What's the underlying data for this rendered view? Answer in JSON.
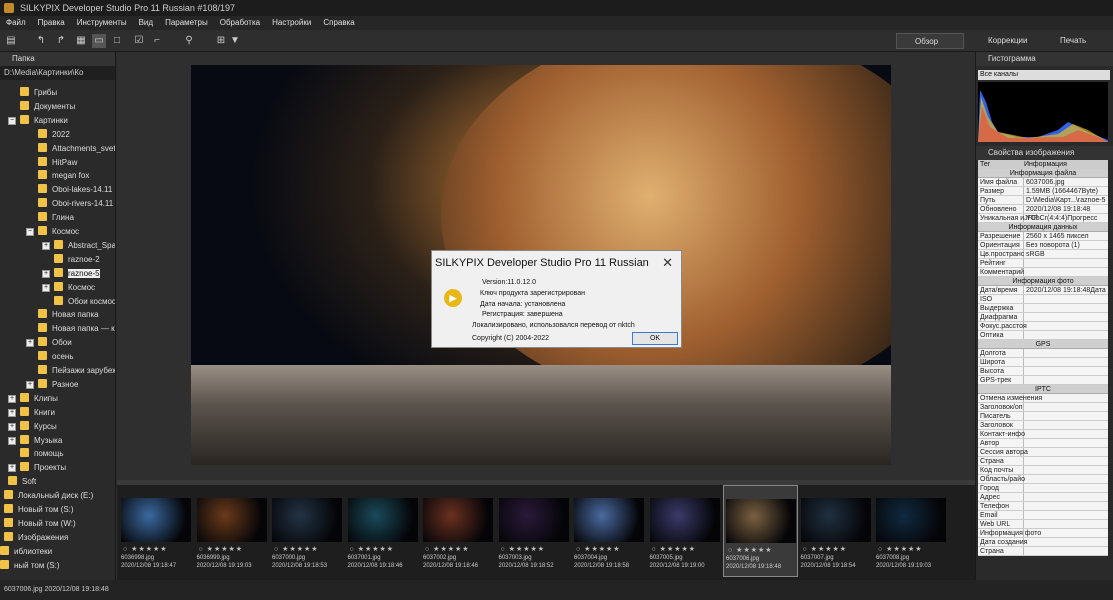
{
  "window": {
    "title": "SILKYPIX Developer Studio Pro 11 Russian   #108/197"
  },
  "menu": [
    "Файл",
    "Правка",
    "Инструменты",
    "Вид",
    "Параметры",
    "Обработка",
    "Настройки",
    "Справка"
  ],
  "modes": {
    "overview": "Обзор",
    "corrections": "Коррекции",
    "print": "Печать"
  },
  "left": {
    "header": "Папка",
    "path": "D:\\Media\\Картинки\\Ко",
    "tree": [
      {
        "label": "Грибы",
        "indent": 20
      },
      {
        "label": "Документы",
        "indent": 20
      },
      {
        "label": "Картинки",
        "indent": 20,
        "pm": "−"
      },
      {
        "label": "2022",
        "indent": 38
      },
      {
        "label": "Attachments_svetk",
        "indent": 38
      },
      {
        "label": "HitPaw",
        "indent": 38
      },
      {
        "label": "megan fox",
        "indent": 38
      },
      {
        "label": "Oboi-lakes-14.11",
        "indent": 38
      },
      {
        "label": "Oboi-rivers-14.11",
        "indent": 38
      },
      {
        "label": "Глина",
        "indent": 38
      },
      {
        "label": "Космос",
        "indent": 38,
        "pm": "−"
      },
      {
        "label": "Abstract_Spac",
        "indent": 54,
        "pm": "+"
      },
      {
        "label": "raznoe-2",
        "indent": 54
      },
      {
        "label": "raznoe-5",
        "indent": 54,
        "pm": "+"
      },
      {
        "label": "Космос",
        "indent": 54,
        "pm": "+"
      },
      {
        "label": "Обои космос",
        "indent": 54
      },
      {
        "label": "Новая папка",
        "indent": 38
      },
      {
        "label": "Новая папка — ко",
        "indent": 38
      },
      {
        "label": "Обои",
        "indent": 38,
        "pm": "+"
      },
      {
        "label": "осень",
        "indent": 38
      },
      {
        "label": "Пейзажи зарубеж",
        "indent": 38
      },
      {
        "label": "Разное",
        "indent": 38,
        "pm": "+"
      },
      {
        "label": "Клипы",
        "indent": 20,
        "pm": "+"
      },
      {
        "label": "Книги",
        "indent": 20,
        "pm": "+"
      },
      {
        "label": "Курсы",
        "indent": 20,
        "pm": "+"
      },
      {
        "label": "Музыка",
        "indent": 20,
        "pm": "+"
      },
      {
        "label": "помощь",
        "indent": 20
      },
      {
        "label": "Проекты",
        "indent": 20,
        "pm": "+"
      },
      {
        "label": "Soft",
        "indent": 8
      },
      {
        "label": "Локальный диск (E:)",
        "indent": 4,
        "pm": "+"
      },
      {
        "label": "Новый том (S:)",
        "indent": 4,
        "pm": "+"
      },
      {
        "label": "Новый том (W:)",
        "indent": 4,
        "pm": "+"
      },
      {
        "label": "Изображения",
        "indent": 4,
        "pm": "+"
      },
      {
        "label": "иблиотеки",
        "indent": 0
      },
      {
        "label": "ный том (S:)",
        "indent": 0
      }
    ]
  },
  "dialog": {
    "title": "SILKYPIX Developer Studio Pro 11 Russian",
    "version": "Version:11.0.12.0",
    "key": "Ключ продукта зарегистрирован",
    "start": "Дата начала: установлена",
    "reg": "Регистрация: завершена",
    "loc": "Локализировано, использовался перевод от nktch",
    "copy": "Copyright (C) 2004-2022",
    "ok": "OK",
    "close": "✕"
  },
  "thumbs": [
    {
      "name": "6036998.jpg",
      "date": "2020/12/08 19:18:47",
      "color": "#3a6aa0"
    },
    {
      "name": "6036999.jpg",
      "date": "2020/12/08 19:19:03",
      "color": "#6a3a1a"
    },
    {
      "name": "6037000.jpg",
      "date": "2020/12/08 19:18:53",
      "color": "#223344"
    },
    {
      "name": "6037001.jpg",
      "date": "2020/12/08 19:18:46",
      "color": "#1a4a5a"
    },
    {
      "name": "6037002.jpg",
      "date": "2020/12/08 19:18:46",
      "color": "#6a3020"
    },
    {
      "name": "6037003.jpg",
      "date": "2020/12/08 19:18:52",
      "color": "#2a1a3a"
    },
    {
      "name": "6037004.jpg",
      "date": "2020/12/08 19:18:58",
      "color": "#4a6aa0"
    },
    {
      "name": "6037005.jpg",
      "date": "2020/12/08 19:19:00",
      "color": "#3a3a6a"
    },
    {
      "name": "6037006.jpg",
      "date": "2020/12/08 19:18:48",
      "color": "#7a6040"
    },
    {
      "name": "6037007.jpg",
      "date": "2020/12/08 19:18:54",
      "color": "#203040"
    },
    {
      "name": "6037008.jpg",
      "date": "2020/12/08 19:19:03",
      "color": "#102a40"
    }
  ],
  "right": {
    "histogram": "Гистограмма",
    "channels": "Все каналы",
    "props": "Свойства изображения",
    "tag": "Тег",
    "info": "Информация",
    "rows": [
      {
        "s": "Информация файла"
      },
      {
        "k": "Имя файла",
        "v": "6037006.jpg"
      },
      {
        "k": "Размер",
        "v": "1.59MB (1664467Byte)"
      },
      {
        "k": "Путь",
        "v": "D:\\Media\\Карт...\\raznoe-5"
      },
      {
        "k": "Обновлено",
        "v": "2020/12/08 19:18:48"
      },
      {
        "k": "Уникальная иJFIF",
        "v": "YCbCr(4:4:4)Прогресс"
      },
      {
        "s": "Информация данных"
      },
      {
        "k": "Разрешение",
        "v": "2560 x 1465 пиксел"
      },
      {
        "k": "Ориентация",
        "v": "Без поворота (1)"
      },
      {
        "k": "Цв.пространс",
        "v": "sRGB"
      },
      {
        "k": "Рейтинг",
        "v": ""
      },
      {
        "k": "Комментарий",
        "v": ""
      },
      {
        "s": "Информация фото"
      },
      {
        "k": "Дата/время",
        "v": "2020/12/08 19:18:48Дата"
      },
      {
        "k": "ISO",
        "v": ""
      },
      {
        "k": "Выдержка",
        "v": ""
      },
      {
        "k": "Диафрагма",
        "v": ""
      },
      {
        "k": "Фокус.расстоя",
        "v": ""
      },
      {
        "k": "Оптика",
        "v": ""
      },
      {
        "s": "GPS"
      },
      {
        "k": "Долгота",
        "v": ""
      },
      {
        "k": "Широта",
        "v": ""
      },
      {
        "k": "Высота",
        "v": ""
      },
      {
        "k": "GPS-трек",
        "v": ""
      },
      {
        "s": "IPTC"
      },
      {
        "k": "Отмена изменения",
        "v": ""
      },
      {
        "k": "Заголовок/оп",
        "v": ""
      },
      {
        "k": "Писатель",
        "v": ""
      },
      {
        "k": "Заголовок",
        "v": ""
      },
      {
        "k": "Контакт-инфо",
        "v": ""
      },
      {
        "k": "Автор",
        "v": ""
      },
      {
        "k": "Сессия автора",
        "v": ""
      },
      {
        "k": "Страна",
        "v": ""
      },
      {
        "k": "Код почты",
        "v": ""
      },
      {
        "k": "Область/райо",
        "v": ""
      },
      {
        "k": "Город",
        "v": ""
      },
      {
        "k": "Адрес",
        "v": ""
      },
      {
        "k": "Телефон",
        "v": ""
      },
      {
        "k": "Email",
        "v": ""
      },
      {
        "k": "Web URL",
        "v": ""
      },
      {
        "k": "Информация фото",
        "v": ""
      },
      {
        "k": "Дата создания",
        "v": ""
      },
      {
        "k": "Страна",
        "v": ""
      }
    ]
  },
  "status": "6037006.jpg 2020/12/08 19:18:48"
}
